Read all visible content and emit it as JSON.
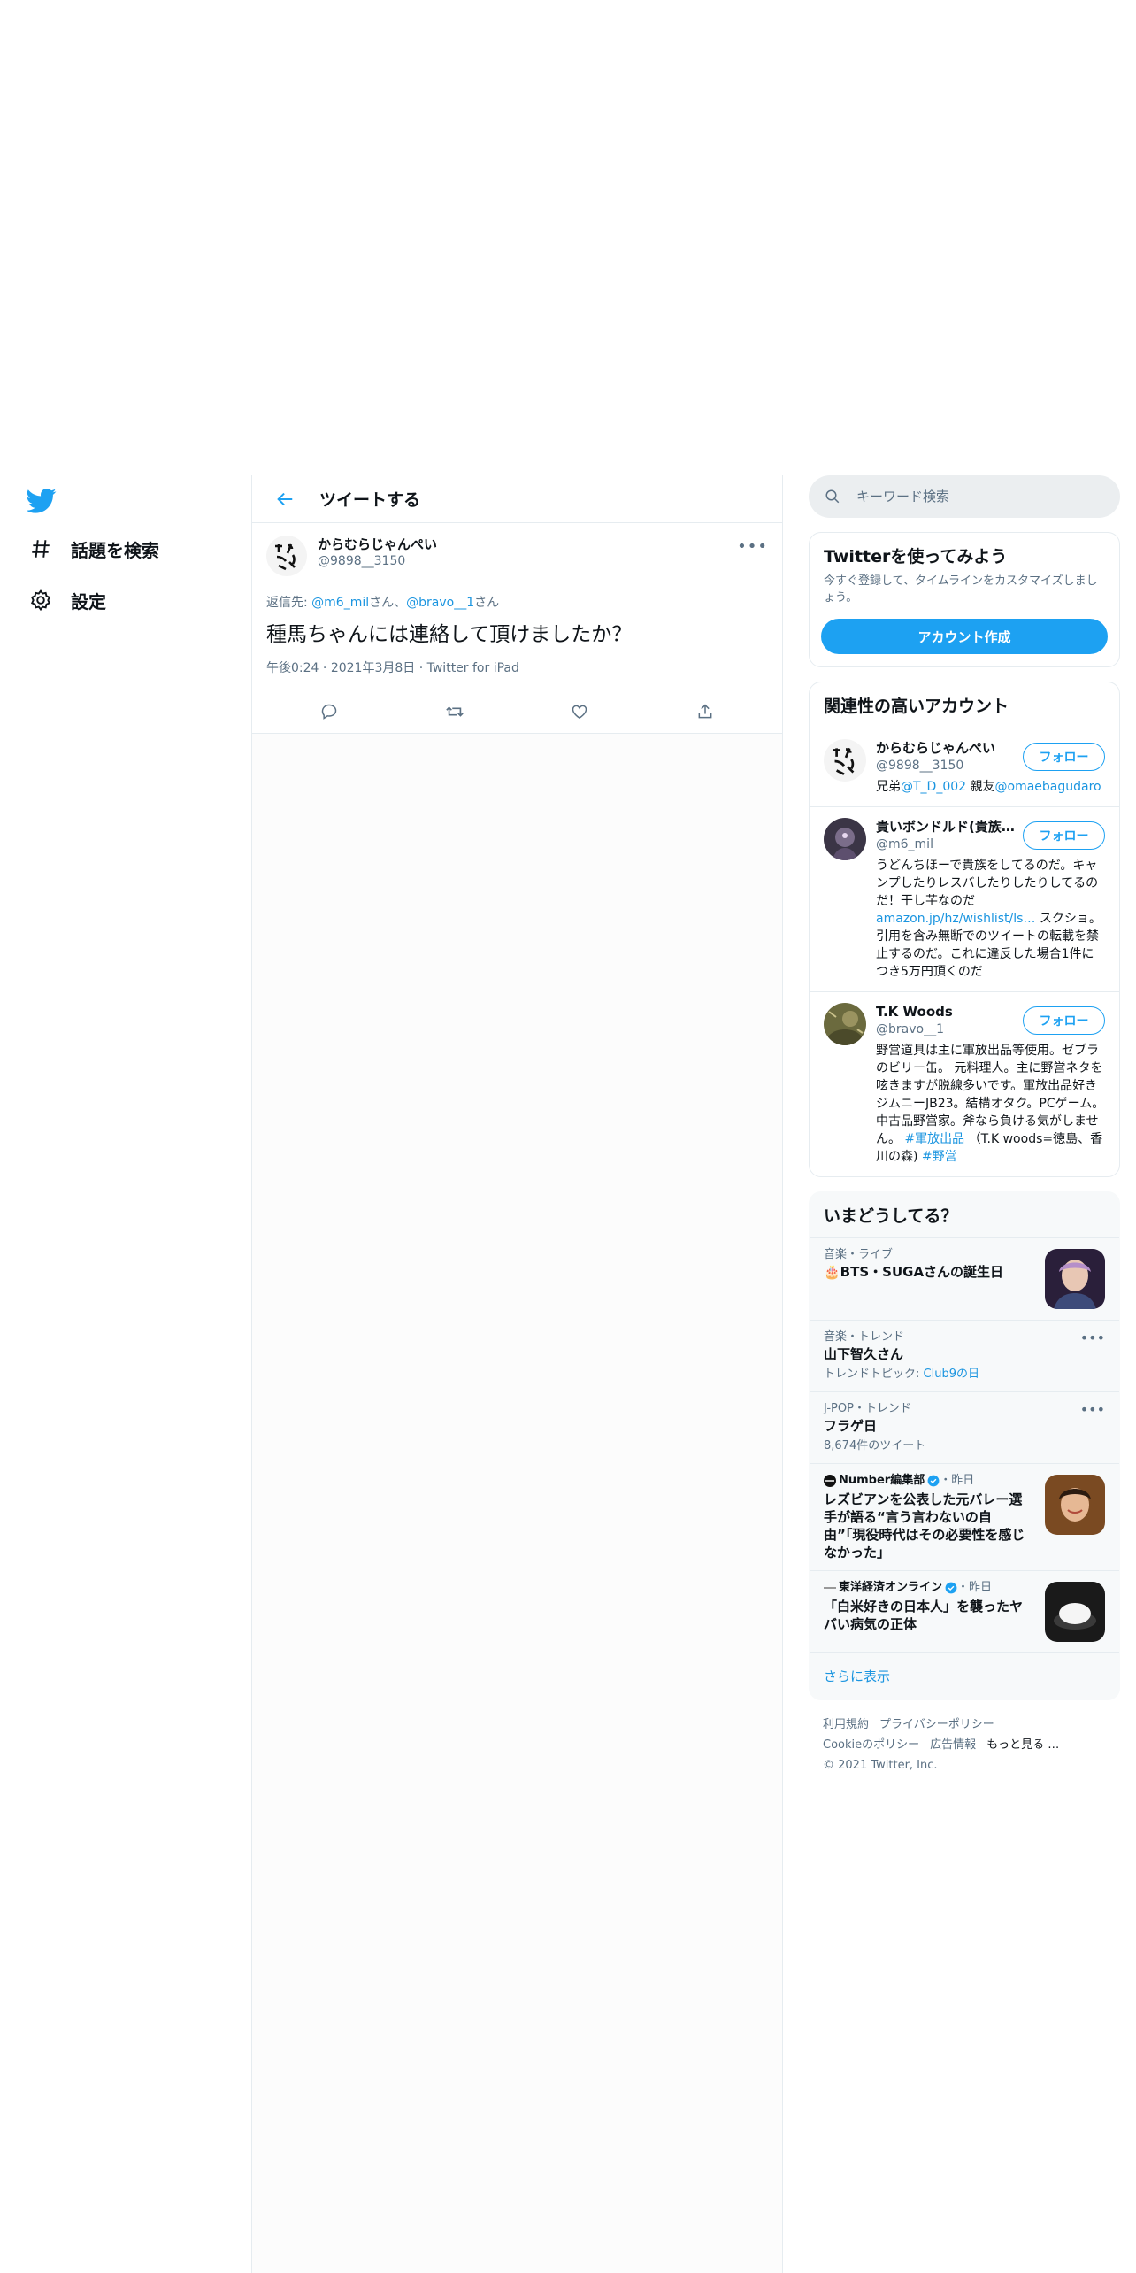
{
  "nav": {
    "items": [
      {
        "label": "話題を検索"
      },
      {
        "label": "設定"
      }
    ]
  },
  "header": {
    "title": "ツイートする"
  },
  "tweet": {
    "user_name": "からむらじゃんぺい",
    "user_handle": "@9898__3150",
    "reply_prefix": "返信先: ",
    "reply_user1": "@m6_mil",
    "reply_suffix1": "さん、",
    "reply_user2": "@bravo__1",
    "reply_suffix2": "さん",
    "text": "種馬ちゃんには連絡して頂けましたか？",
    "time": "午後0:24",
    "date": "2021年3月8日",
    "client": "Twitter for iPad"
  },
  "search": {
    "placeholder": "キーワード検索"
  },
  "signup": {
    "title": "Twitterを使ってみよう",
    "desc": "今すぐ登録して、タイムラインをカスタマイズしましょう。",
    "button": "アカウント作成"
  },
  "related": {
    "title": "関連性の高いアカウント",
    "follow_label": "フォロー",
    "accounts": [
      {
        "name": "からむらじゃんぺい",
        "handle": "@9898__3150",
        "bio_1": "兄弟",
        "bio_link1": "@T_D_002",
        "bio_2": " 親友",
        "bio_link2": "@omaebagudaro"
      },
      {
        "name": "貴いボンドルド(貴族…",
        "handle": "@m6_mil",
        "bio_1": "うどんちほーで貴族をしてるのだ。キャンプしたりレスバしたりしたりしてるのだ！干し芋なのだ",
        "bio_link1": "amazon.jp/hz/wishlist/ls…",
        "bio_2": " スクショ。引用を含み無断でのツイートの転載を禁止するのだ。これに違反した場合1件につき5万円頂くのだ"
      },
      {
        "name": "T.K Woods",
        "handle": "@bravo__1",
        "bio_1": "野営道具は主に軍放出品等使用。ゼブラのビリー缶。 元料理人。主に野営ネタを呟きますが脱線多いです。軍放出品好き ジムニーJB23。結構オタク。PCゲーム。中古品野営家。斧なら負ける気がしません。 ",
        "bio_link1": "#軍放出品",
        "bio_2": " （T.K woods=徳島、香川の森) ",
        "bio_link2": "#野営"
      }
    ]
  },
  "trends": {
    "title": "いまどうしてる？",
    "items": [
      {
        "context": "音楽・ライブ",
        "title": "🎂BTS・SUGAさんの誕生日"
      },
      {
        "context": "音楽・トレンド",
        "title": "山下智久さん",
        "sub_prefix": "トレンドトピック: ",
        "sub_link": "Club9の日"
      },
      {
        "context": "J-POP・トレンド",
        "title": "フラゲ日",
        "sub": "8,674件のツイート"
      },
      {
        "source": "Number編集部",
        "when": "・昨日",
        "title": "レズビアンを公表した元バレー選手が語る“言う言わないの自由”「現役時代はその必要性を感じなかった」"
      },
      {
        "source": "東洋経済オンライン",
        "when": "・昨日",
        "title": "「白米好きの日本人」を襲ったヤバい病気の正体"
      }
    ],
    "show_more": "さらに表示"
  },
  "footer": {
    "links": [
      "利用規約",
      "プライバシーポリシー",
      "Cookieのポリシー",
      "広告情報",
      "もっと見る …"
    ],
    "copyright": "© 2021 Twitter, Inc."
  },
  "colors": {
    "accent": "#1da1f2",
    "link": "#1b95e0",
    "muted": "#5b7083"
  }
}
